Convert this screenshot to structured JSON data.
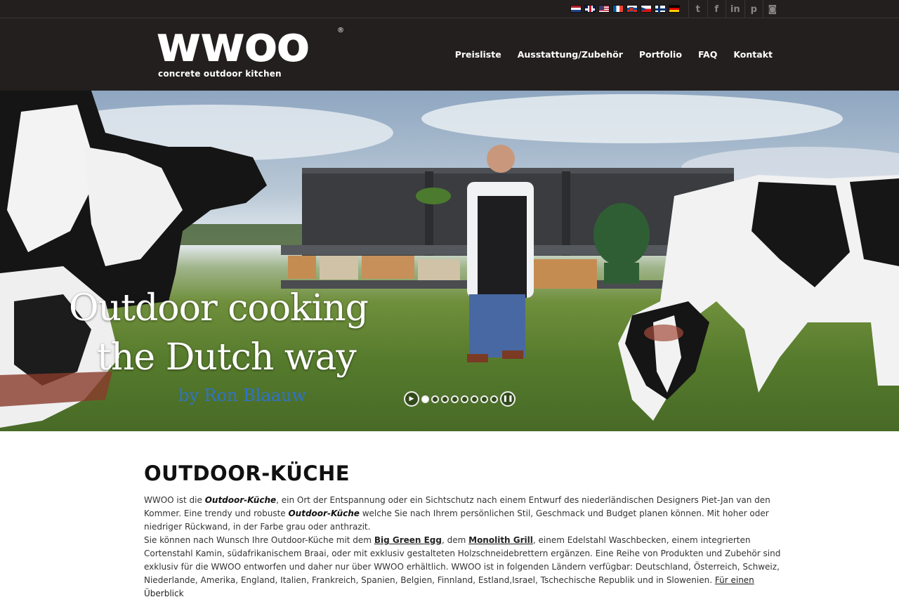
{
  "topbar": {
    "flags": [
      "NL",
      "GB",
      "US",
      "FR",
      "SI",
      "CZ",
      "FI",
      "DE"
    ],
    "social": [
      {
        "name": "twitter-icon",
        "glyph": "t"
      },
      {
        "name": "facebook-icon",
        "glyph": "f"
      },
      {
        "name": "linkedin-icon",
        "glyph": "in"
      },
      {
        "name": "pinterest-icon",
        "glyph": "p"
      },
      {
        "name": "instagram-icon",
        "glyph": "◙"
      }
    ]
  },
  "header": {
    "logo_text": "wwoo",
    "logo_mark": "®",
    "tagline": "concrete outdoor kitchen",
    "nav": [
      "Preisliste",
      "Ausstattung/Zubehör",
      "Portfolio",
      "FAQ",
      "Kontakt"
    ]
  },
  "hero": {
    "line1": "Outdoor cooking",
    "line2": "the Dutch way",
    "byline": "by Ron Blaauw",
    "slides_count": 8,
    "active_slide": 1
  },
  "main": {
    "title": "OUTDOOR-KÜCHE",
    "p1_a": "WWOO ist die ",
    "p1_b": "Outdoor-Küche",
    "p1_c": ", ein Ort der Entspannung oder ein Sichtschutz nach einem Entwurf des niederländischen Designers Piet-Jan van den Kommer. Eine trendy und robuste ",
    "p1_d": "Outdoor-Küche",
    "p1_e": " welche Sie nach Ihrem persönlichen Stil, Geschmack und Budget planen können. Mit hoher oder niedriger Rückwand, in der Farbe grau oder anthrazit.",
    "p2_a": "Sie können nach Wunsch Ihre Outdoor-Küche mit dem ",
    "p2_link1": "Big Green Egg",
    "p2_b": ", dem ",
    "p2_link2": "Monolith Grill",
    "p2_c": ", einem Edelstahl Waschbecken, einem integrierten Cortenstahl Kamin, südafrikanischem Braai, oder mit exklusiv gestalteten Holzschneidebrettern ergänzen. Eine Reihe von Produkten und Zubehör sind exklusiv für die WWOO entworfen und daher nur über WWOO erhältlich. WWOO ist in folgenden Ländern verfügbar: Deutschland, Österreich, Schweiz, Niederlande, Amerika, England, Italien, Frankreich, Spanien, Belgien, Finnland, Estland,Israel, Tschechische Republik und in Slowenien. ",
    "p2_link3": "Für einen Überblick"
  }
}
